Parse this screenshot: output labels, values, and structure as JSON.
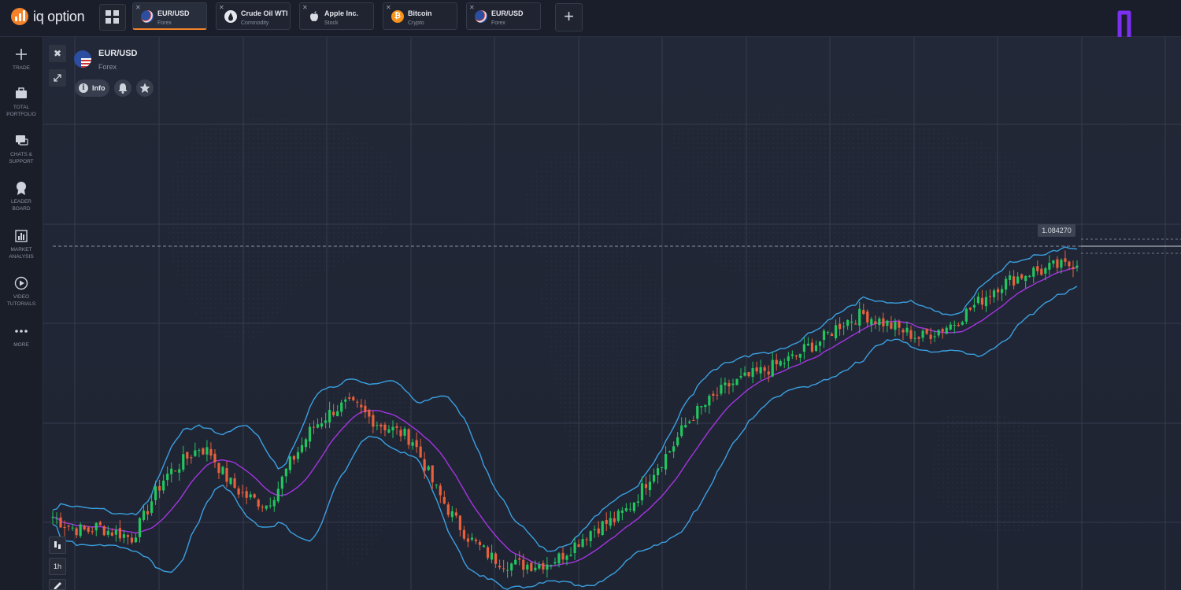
{
  "app": {
    "name": "iq option"
  },
  "tabs": [
    {
      "name": "EUR/USD",
      "type": "Forex",
      "active": true,
      "icon": "us-eu-flag-icon"
    },
    {
      "name": "Crude Oil WTI",
      "type": "Commodity",
      "active": false,
      "icon": "oil-drop-icon"
    },
    {
      "name": "Apple Inc.",
      "type": "Stock",
      "active": false,
      "icon": "apple-icon"
    },
    {
      "name": "Bitcoin",
      "type": "Crypto",
      "active": false,
      "icon": "bitcoin-icon"
    },
    {
      "name": "EUR/USD",
      "type": "Forex",
      "active": false,
      "icon": "us-eu-flag-icon"
    }
  ],
  "sidebar": {
    "items": [
      {
        "label": "TRADE",
        "icon": "plus-icon"
      },
      {
        "label": "TOTAL\nPORTFOLIO",
        "icon": "briefcase-icon"
      },
      {
        "label": "CHATS &\nSUPPORT",
        "icon": "chat-icon"
      },
      {
        "label": "LEADER\nBOARD",
        "icon": "medal-icon"
      },
      {
        "label": "MARKET\nANALYSIS",
        "icon": "bar-chart-icon"
      },
      {
        "label": "VIDEO\nTUTORIALS",
        "icon": "play-icon"
      },
      {
        "label": "MORE",
        "icon": "more-dots-icon"
      }
    ]
  },
  "asset": {
    "name": "EUR/USD",
    "type": "Forex",
    "info_label": "Info"
  },
  "chart_tools": {
    "timeframe": "1h"
  },
  "current_price": "1.084270",
  "colors": {
    "up": "#22c55e",
    "down": "#e8603c",
    "band": "#3aa0e0",
    "mid": "#a335e0",
    "accent": "#f2832a",
    "brand": "#7b2ff0"
  },
  "chart_data": {
    "type": "candlestick",
    "indicator": "Bollinger Bands",
    "last_price": 1.08427,
    "close_series": [
      0.53,
      0.5,
      0.48,
      0.47,
      0.49,
      0.47,
      0.46,
      0.44,
      0.52,
      0.62,
      0.7,
      0.74,
      0.78,
      0.82,
      0.8,
      0.72,
      0.66,
      0.62,
      0.6,
      0.58,
      0.65,
      0.75,
      0.82,
      0.9,
      0.94,
      0.98,
      1.0,
      0.99,
      0.95,
      0.92,
      0.9,
      0.88,
      0.85,
      0.75,
      0.65,
      0.57,
      0.5,
      0.44,
      0.4,
      0.36,
      0.34,
      0.33,
      0.33,
      0.33,
      0.34,
      0.36,
      0.4,
      0.44,
      0.48,
      0.5,
      0.52,
      0.56,
      0.62,
      0.7,
      0.76,
      0.82,
      0.9,
      0.96,
      1.0,
      1.04,
      1.08,
      1.1,
      1.12,
      1.14,
      1.16,
      1.18,
      1.2,
      1.24,
      1.26,
      1.3,
      1.34,
      1.36,
      1.38,
      1.36,
      1.34,
      1.32,
      1.3,
      1.28,
      1.3,
      1.32,
      1.34,
      1.38,
      1.42,
      1.46,
      1.5,
      1.52,
      1.54,
      1.56,
      1.56,
      1.58,
      1.58,
      1.6
    ]
  }
}
